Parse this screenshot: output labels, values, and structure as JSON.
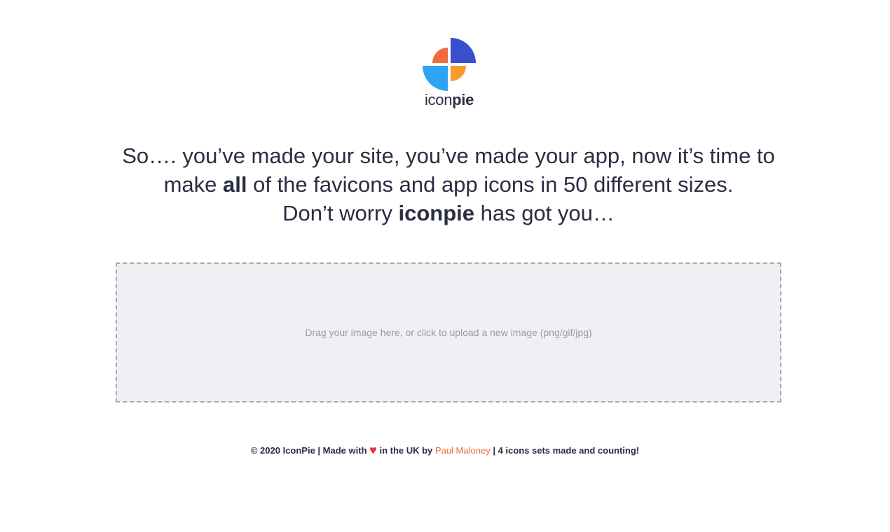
{
  "logo": {
    "word_light": "icon",
    "word_bold": "pie",
    "colors": {
      "top_right": "#3a4fcb",
      "top_left": "#f26a3d",
      "bottom_left": "#2ea4f7",
      "bottom_right": "#f99a2f"
    }
  },
  "headline": {
    "line1": "So…. you’ve made your site, you’ve made your app, now it’s time to",
    "line2_prefix": "make ",
    "line2_bold": "all",
    "line2_suffix": " of the favicons and app icons in 50 different sizes.",
    "line3_prefix": "Don’t worry ",
    "line3_bold": "iconpie",
    "line3_suffix": " has got you…"
  },
  "dropzone": {
    "text": "Drag your image here, or click to upload a new image (png/gif/jpg)"
  },
  "footer": {
    "copyright": "© 2020 IconPie | Made with",
    "heart": "♥",
    "middle": "in the UK by",
    "author_link": "Paul Maloney",
    "counter": "| 4 icons sets made and counting!"
  }
}
